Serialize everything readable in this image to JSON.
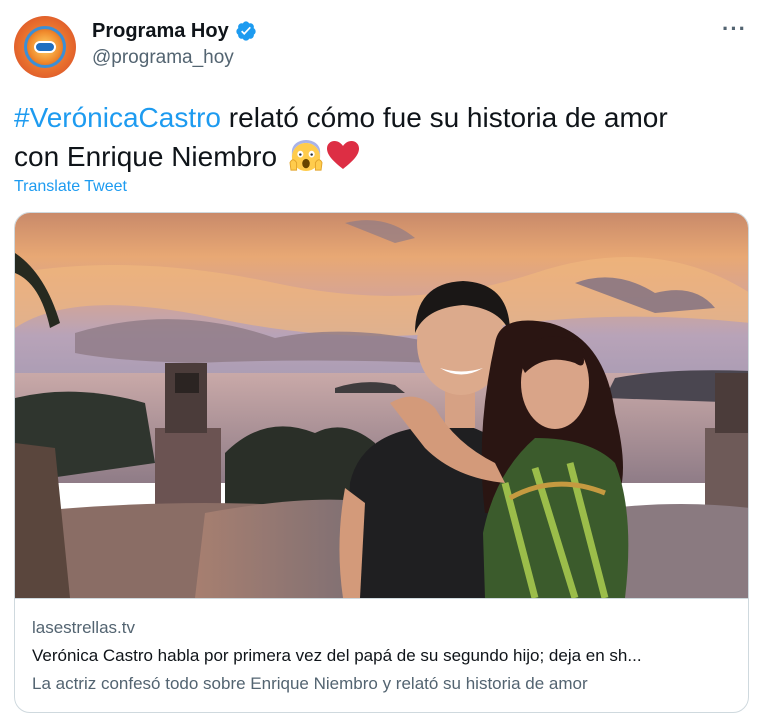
{
  "author": {
    "display_name": "Programa Hoy",
    "handle": "@programa_hoy",
    "verified": true,
    "avatar_icon": "programa-hoy-logo"
  },
  "menu": {
    "more_label": "···"
  },
  "tweet": {
    "hashtag": "#VerónicaCastro",
    "text_line1": " relató cómo fue su historia de amor",
    "text_line2": "con Enrique Niembro ",
    "emojis": [
      "face-screaming-in-fear",
      "red-heart"
    ],
    "translate_label": "Translate Tweet"
  },
  "card": {
    "domain": "lasestrellas.tv",
    "title": "Verónica Castro habla por primera vez del papá de su segundo hijo; deja en sh...",
    "description": "La actriz confesó todo sobre Enrique Niembro y relató su historia de amor"
  },
  "colors": {
    "link": "#1d9bf0",
    "text": "#0f1419",
    "secondary": "#536471",
    "border": "#cfd9de",
    "heart": "#e0245e"
  }
}
